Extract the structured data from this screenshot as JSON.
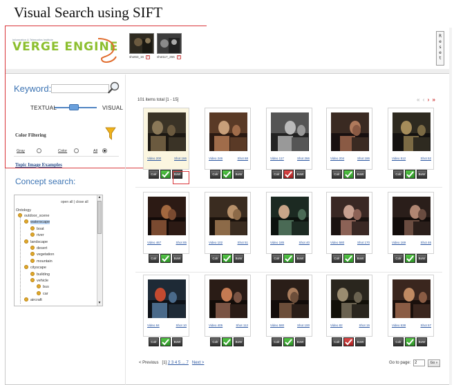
{
  "caption": "Visual Search using SIFT",
  "header": {
    "logo_small_text": "Information & Telematics Institute",
    "logo_text": "VERGE ENGINE",
    "selected": [
      {
        "label": "shot63_16"
      },
      {
        "label": "shot117_266"
      }
    ],
    "reset_label": "Reset"
  },
  "left": {
    "keyword_label": "Keyword:",
    "keyword_value": "",
    "textual_label": "TEXTUAL",
    "visual_label": "VISUAL",
    "slider_position": 0.4,
    "color_filtering_label": "Color Filtering",
    "radio": [
      {
        "label": "Gray",
        "checked": false
      },
      {
        "label": "Color",
        "checked": false
      },
      {
        "label": "All",
        "checked": true
      }
    ],
    "topic_link": "Topic Image Examples",
    "concept_title": "Concept search:",
    "tree": {
      "controls": "open all | close all",
      "root": "Ontology",
      "items": [
        {
          "label": "outdoor_scene",
          "level": 1,
          "selected": false
        },
        {
          "label": "waterscape",
          "level": 2,
          "selected": true
        },
        {
          "label": "boat",
          "level": 3,
          "selected": false
        },
        {
          "label": "river",
          "level": 3,
          "selected": false
        },
        {
          "label": "landscape",
          "level": 2,
          "selected": false
        },
        {
          "label": "desert",
          "level": 3,
          "selected": false
        },
        {
          "label": "vegetation",
          "level": 3,
          "selected": false
        },
        {
          "label": "mountain",
          "level": 3,
          "selected": false
        },
        {
          "label": "cityscape",
          "level": 2,
          "selected": false
        },
        {
          "label": "building",
          "level": 3,
          "selected": false
        },
        {
          "label": "vehicle",
          "level": 3,
          "selected": false
        },
        {
          "label": "bus",
          "level": 4,
          "selected": false
        },
        {
          "label": "car",
          "level": 4,
          "selected": false
        },
        {
          "label": "aircraft",
          "level": 2,
          "selected": false
        }
      ]
    }
  },
  "results": {
    "count_text": "101 items total [1 - 15]",
    "pager_icons": "«‹›»",
    "button_labels": {
      "color": "Colr",
      "bow": "BoW"
    },
    "items": [
      {
        "video": "Video 200",
        "shot": "Shot 166",
        "mark": "green",
        "highlight": true,
        "palette": [
          "#3a3326",
          "#6b5a3f",
          "#1c1812",
          "#8a7858"
        ]
      },
      {
        "video": "Video 246",
        "shot": "Shot 68",
        "mark": "green",
        "highlight": false,
        "palette": [
          "#5a3a26",
          "#a06c4a",
          "#2b1a12",
          "#c89f7a"
        ]
      },
      {
        "video": "Video 117",
        "shot": "Shot 266",
        "mark": "red",
        "highlight": false,
        "palette": [
          "#555555",
          "#999999",
          "#222222",
          "#bbbbbb"
        ]
      },
      {
        "video": "Video 204",
        "shot": "Shot 186",
        "mark": "green",
        "highlight": false,
        "palette": [
          "#3a2a22",
          "#8a5a44",
          "#181010",
          "#b07a5c"
        ]
      },
      {
        "video": "Video 512",
        "shot": "Shot 52",
        "mark": "green",
        "highlight": false,
        "palette": [
          "#2e2a20",
          "#7b6a44",
          "#141210",
          "#a58c5a"
        ]
      },
      {
        "video": "Video 467",
        "shot": "Shot 85",
        "mark": "green",
        "highlight": false,
        "palette": [
          "#2c1a14",
          "#7a4a30",
          "#120a08",
          "#a3683f"
        ]
      },
      {
        "video": "Video 102",
        "shot": "Shot 51",
        "mark": "green",
        "highlight": false,
        "palette": [
          "#3a2c20",
          "#8c6a48",
          "#1a120c",
          "#b8916a"
        ]
      },
      {
        "video": "Video 185",
        "shot": "Shot 40",
        "mark": "green",
        "highlight": false,
        "palette": [
          "#1c2a22",
          "#4a6a55",
          "#0c120e",
          "#c9a588"
        ]
      },
      {
        "video": "Video 580",
        "shot": "Shot 170",
        "mark": "green",
        "highlight": false,
        "palette": [
          "#3a2824",
          "#8c6256",
          "#1a1210",
          "#c8a090"
        ]
      },
      {
        "video": "Video 169",
        "shot": "Shot 46",
        "mark": "green",
        "highlight": false,
        "palette": [
          "#2a1e1a",
          "#6a4c40",
          "#120c0a",
          "#b08672"
        ]
      },
      {
        "video": "Video 84",
        "shot": "Shot 10",
        "mark": "green",
        "highlight": false,
        "palette": [
          "#1e2a36",
          "#4a6a8a",
          "#0e1218",
          "#c34a30"
        ]
      },
      {
        "video": "Video 405",
        "shot": "Shot 112",
        "mark": "green",
        "highlight": false,
        "palette": [
          "#2a1c16",
          "#7a5444",
          "#120c08",
          "#c47a52"
        ]
      },
      {
        "video": "Video 580",
        "shot": "Shot 100",
        "mark": "green",
        "highlight": false,
        "palette": [
          "#2a1e18",
          "#6c4e3a",
          "#120c0a",
          "#a87c5c"
        ]
      },
      {
        "video": "Video 82",
        "shot": "Shot 15",
        "mark": "red",
        "highlight": false,
        "palette": [
          "#2a261e",
          "#6a6250",
          "#121008",
          "#9a8c70"
        ]
      },
      {
        "video": "Video 538",
        "shot": "Shot 57",
        "mark": "green",
        "highlight": false,
        "palette": [
          "#3a261e",
          "#8a5c44",
          "#1a100c",
          "#c08a62"
        ]
      }
    ],
    "prev_label": "< Previous",
    "page_current": "[1]",
    "pages": "2 3 4 5 ... 7",
    "next_label": "Next >",
    "goto_label": "Go to page:",
    "goto_value": "2",
    "go_label": "Go »"
  }
}
